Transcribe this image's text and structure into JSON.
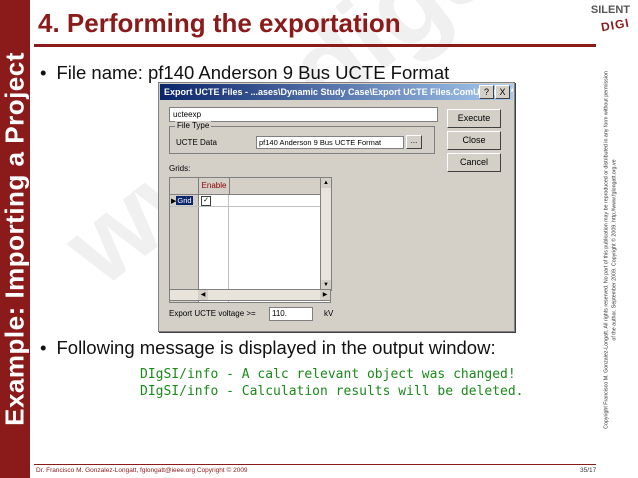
{
  "sidebar": {
    "text": "Example: Importing a Project"
  },
  "header": {
    "title": "4. Performing the exportation"
  },
  "logo": {
    "line1": "SILENT",
    "line2": "DIGI"
  },
  "watermark": {
    "text": "www.digsilent.com.ve"
  },
  "bullets": [
    {
      "dot": "•",
      "text": "File name: pf140 Anderson 9 Bus UCTE Format"
    },
    {
      "dot": "•",
      "text": "Following message is displayed in the output window:"
    }
  ],
  "dialog": {
    "title": "Export UCTE Files - ...ases\\Dynamic Study Case\\Export UCTE Files.ComUcteexp *",
    "help_label": "?",
    "close_label": "X",
    "name_value": "ucteexp",
    "file_type_legend": "File Type",
    "ucte_data_label": "UCTE Data",
    "ucte_data_value": "pf140 Anderson 9 Bus UCTE Format",
    "browse_label": "...",
    "execute_label": "Execute",
    "close_button_label": "Close",
    "cancel_label": "Cancel",
    "grids_label": "Grids:",
    "enable_header": "Enable",
    "row_arrow": "▶",
    "row_label": "Grid",
    "row_check": "✓",
    "scroll_up": "▲",
    "scroll_down": "▼",
    "scroll_left": "◀",
    "scroll_right": "▶",
    "voltage_label": "Export UCTE voltage >=",
    "voltage_value": "110.",
    "voltage_unit": "kV"
  },
  "output": {
    "line1": "DIgSI/info - A calc relevant object was changed!",
    "line2": "DIgSI/info - Calculation results will be deleted."
  },
  "footer": {
    "author": "Dr. Francisco M. Gonzalez-Longatt,  fglongatt@ieee.org  Copyright © 2009",
    "page": "35/17"
  },
  "copyright": {
    "line1": "Copyright Francisco M. Gonzalez-Longatt. All rights reserved. No part of this publication may be reproduced or distributed in any form without permission",
    "line2": "of the author. September 2009. Copyright © 2009. http://www.fglongatt.org.ve"
  }
}
